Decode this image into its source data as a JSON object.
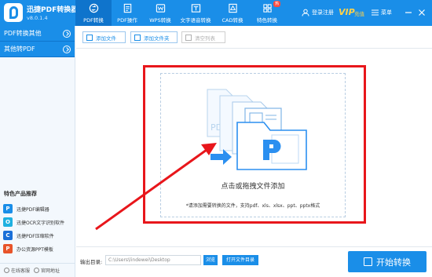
{
  "app": {
    "title": "迅捷PDF转换器",
    "version": "v8.0.1.4"
  },
  "nav": [
    {
      "label": "PDF转换",
      "icon": "convert-icon"
    },
    {
      "label": "PDF操作",
      "icon": "pdf-operations-icon"
    },
    {
      "label": "WPS转换",
      "icon": "wps-icon"
    },
    {
      "label": "文字语音转换",
      "icon": "text-to-speech-icon"
    },
    {
      "label": "CAD转换",
      "icon": "cad-icon"
    },
    {
      "label": "特色转换",
      "icon": "feature-convert-icon",
      "badge": "热"
    }
  ],
  "account": {
    "login": "登录注册",
    "vip": "VIP",
    "vip_sub": "充值",
    "menu": "菜单"
  },
  "sidebar": {
    "items": [
      {
        "label": "PDF转换其他"
      },
      {
        "label": "其他转PDF"
      }
    ],
    "products_title": "特色产品推荐",
    "products": [
      {
        "label": "迅捷PDF编辑器",
        "color": "#1a8ee8"
      },
      {
        "label": "迅捷OCR文字识别软件",
        "color": "#1fb0e0"
      },
      {
        "label": "迅捷PDF压缩软件",
        "color": "#1a6fd8"
      },
      {
        "label": "办公资源PPT模板",
        "color": "#e8542a"
      }
    ],
    "footer": {
      "service": "在线客服",
      "website": "官网地址"
    }
  },
  "toolbar": {
    "add_file": "添加文件",
    "add_folder": "添加文件夹",
    "clear_list": "清空列表"
  },
  "drop": {
    "text": "点击或拖拽文件添加",
    "hint": "*请添加需要转换的文件，支持pdf、xls、xlsx、ppt、pptx格式"
  },
  "bottom": {
    "output_label": "输出目录:",
    "output_path": "C:\\Users\\lindewei\\Desktop",
    "browse": "浏览",
    "open_folder": "打开文件目录",
    "start": "开始转换"
  },
  "colors": {
    "primary": "#1a8ee8",
    "highlight": "#e8161b"
  }
}
